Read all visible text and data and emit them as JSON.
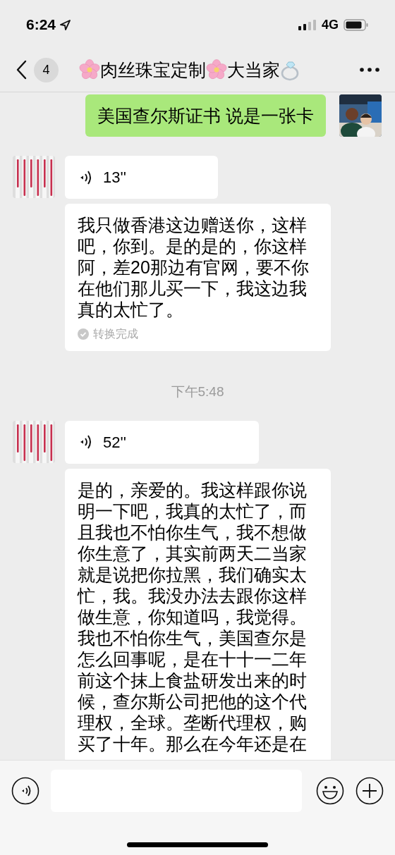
{
  "status_bar": {
    "time": "6:24",
    "network": "4G"
  },
  "nav": {
    "unread_count": "4",
    "title": [
      {
        "kind": "flower"
      },
      {
        "kind": "text",
        "text": "肉丝珠宝定制"
      },
      {
        "kind": "flower"
      },
      {
        "kind": "text",
        "text": "大当家"
      },
      {
        "kind": "ring"
      }
    ]
  },
  "messages": [
    {
      "kind": "text",
      "outgoing": true,
      "text": "美国查尔斯证书 说是一张卡"
    },
    {
      "kind": "voice",
      "outgoing": false,
      "duration": "13''",
      "transcript": "我只做香港这边赠送你，这样吧，你到。是的是的，你这样阿，差20那边有官网，要不你在他们那儿买一下，我这边我真的太忙了。",
      "transcript_status": "转换完成"
    },
    {
      "kind": "time",
      "text": "下午5:48"
    },
    {
      "kind": "voice",
      "outgoing": false,
      "duration": "52''",
      "transcript": "是的，亲爱的。我这样跟你说明一下吧，我真的太忙了，而且我也不怕你生气，我不想做你生意了，其实前两天二当家就是说把你拉黑，我们确实太忙，我。我没办法去跟你这样做生意，你知道吗，我觉得。我也不怕你生气，美国查尔是怎么回事呢，是在十十一二年前这个抹上食盐研发出来的时候，查尔斯公司把他的这个代理权，全球。垄断代理权，购买了十年。那么在今年还是在"
    }
  ]
}
